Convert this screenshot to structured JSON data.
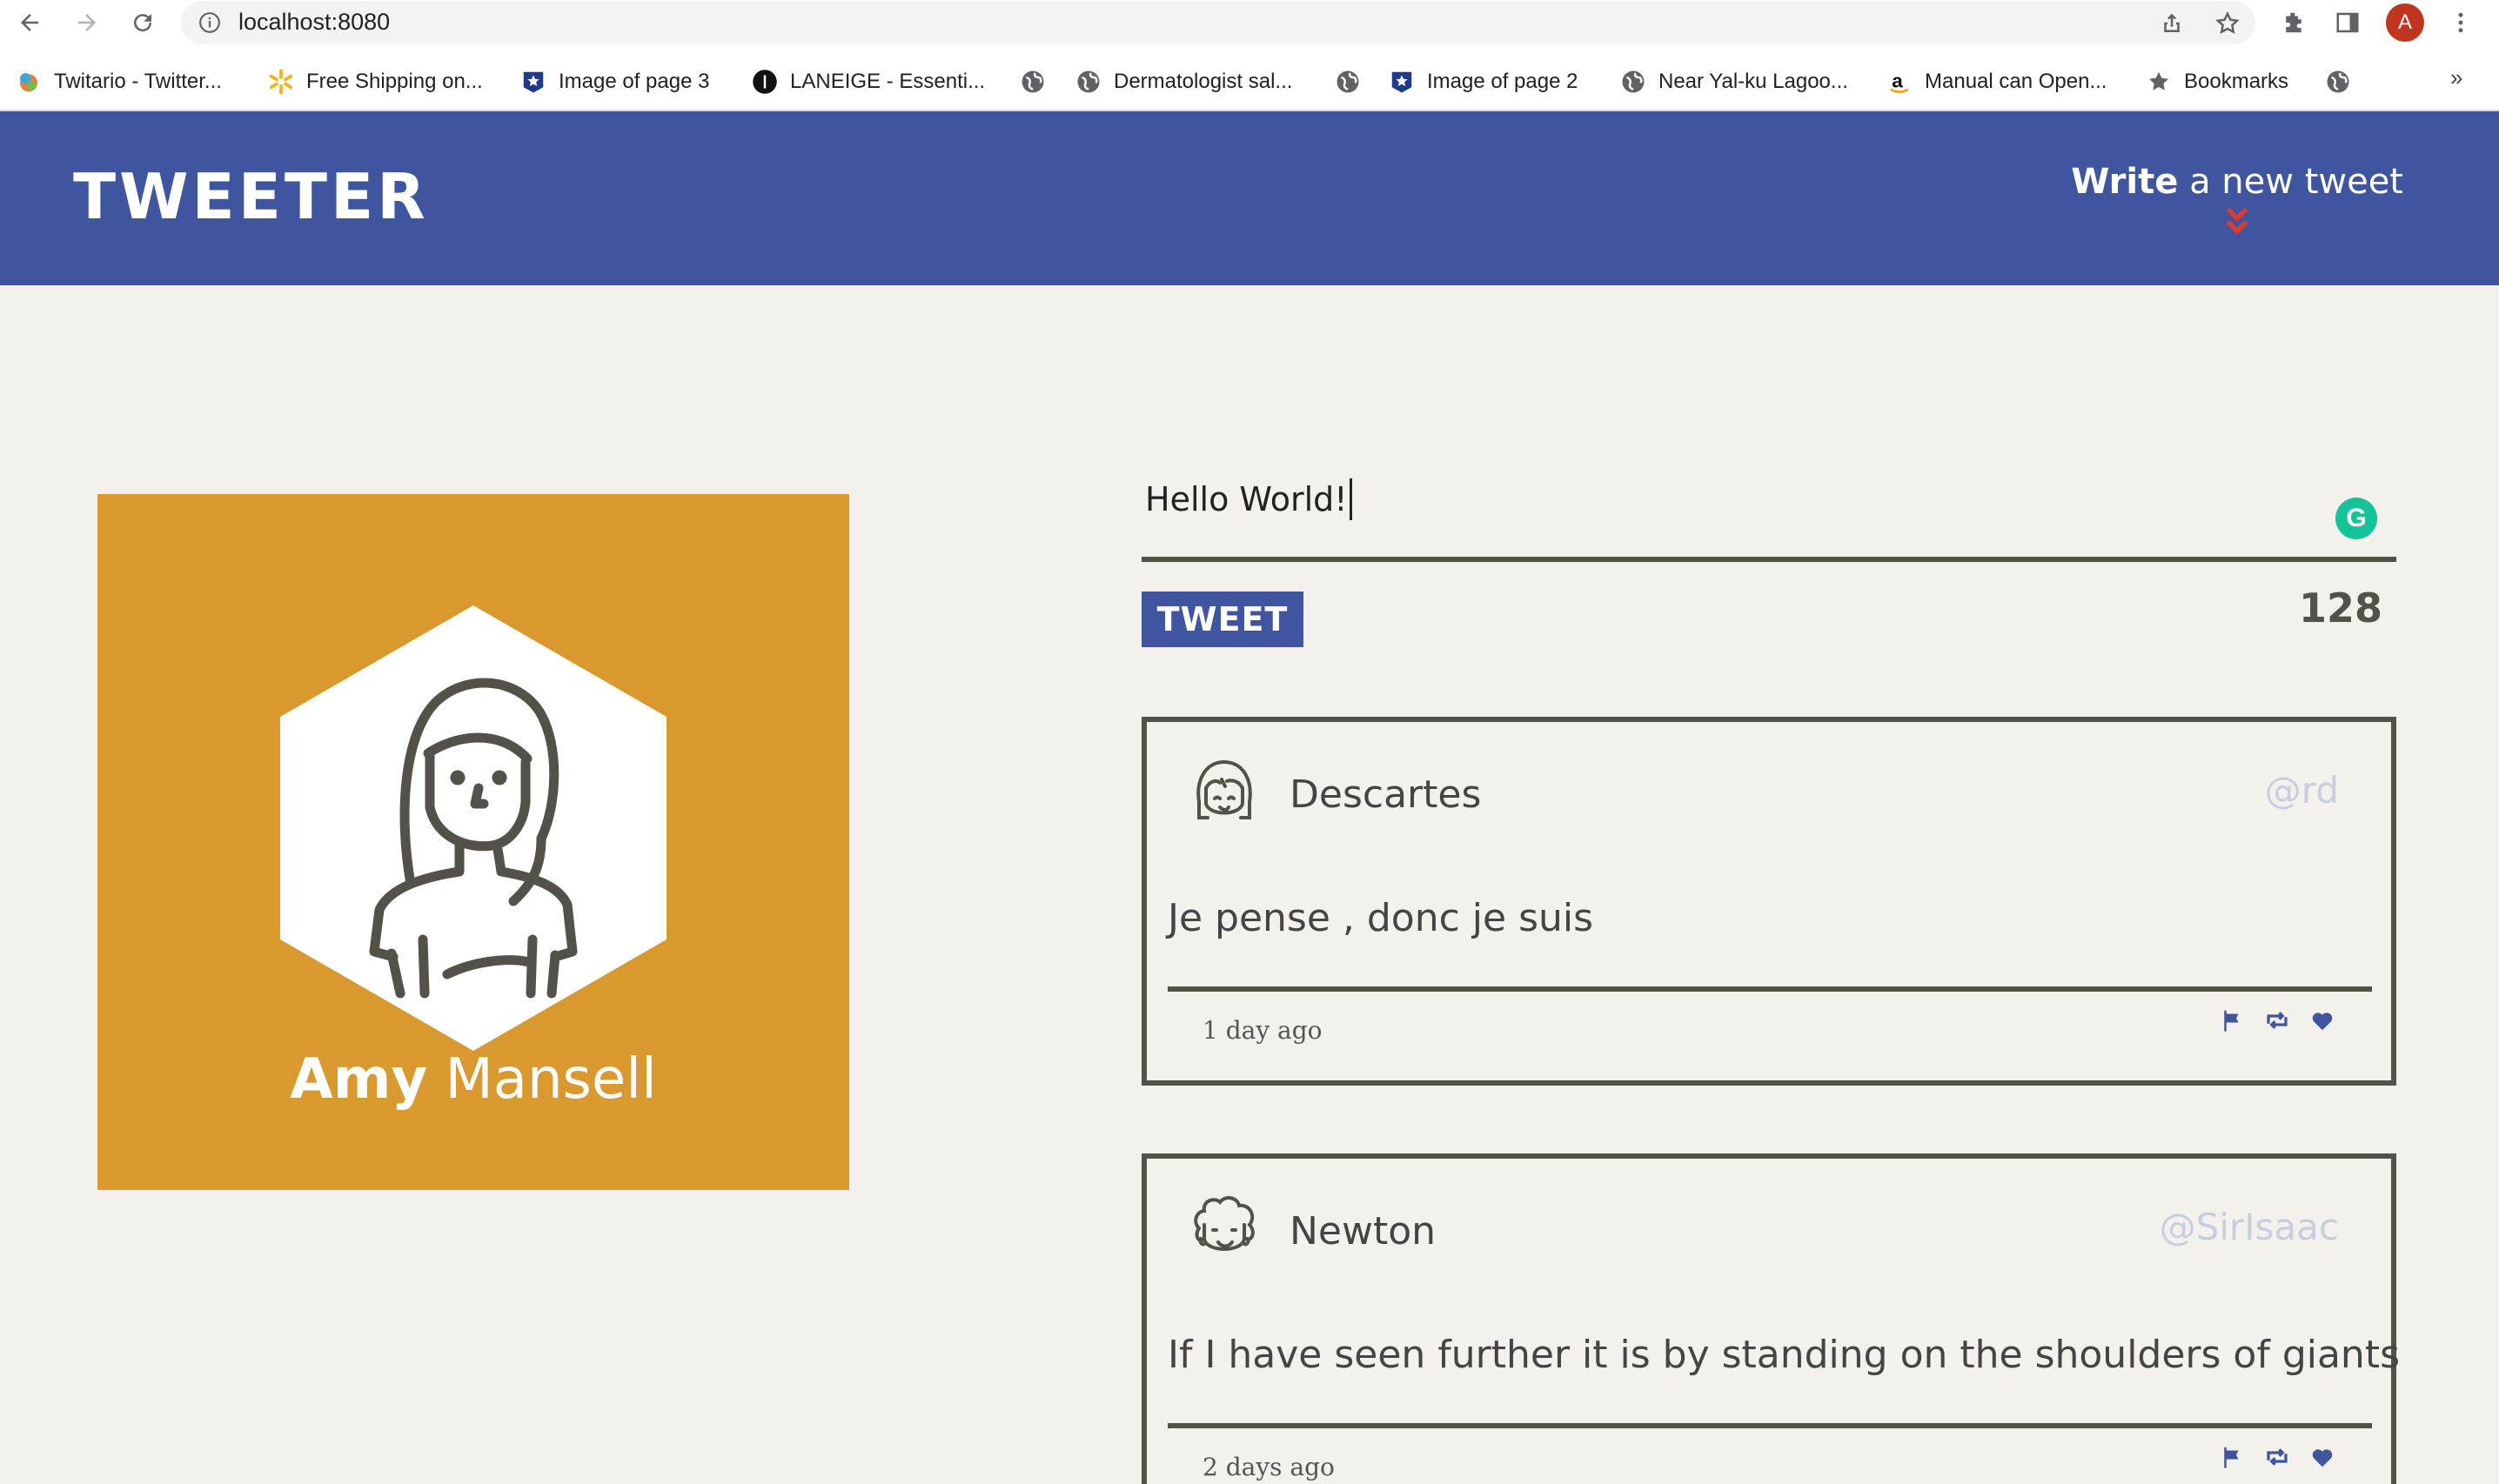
{
  "browser": {
    "url": "localhost:8080",
    "profile_initial": "A",
    "bookmarks": [
      {
        "label": "Twitario - Twitter...",
        "icon": "colorful-logo-icon"
      },
      {
        "label": "Free Shipping on...",
        "icon": "walmart-spark-icon"
      },
      {
        "label": "Image of page 3",
        "icon": "star-shield-icon"
      },
      {
        "label": "LANEIGE - Essenti...",
        "icon": "black-circle-icon"
      },
      {
        "label": "",
        "icon": "globe-icon"
      },
      {
        "label": "Dermatologist sal...",
        "icon": "globe-icon"
      },
      {
        "label": "",
        "icon": "globe-icon"
      },
      {
        "label": "Image of page 2",
        "icon": "star-shield-icon"
      },
      {
        "label": "Near Yal-ku Lagoo...",
        "icon": "globe-icon"
      },
      {
        "label": "Manual can Open...",
        "icon": "amazon-icon"
      },
      {
        "label": "Bookmarks",
        "icon": "star-icon"
      },
      {
        "label": "",
        "icon": "globe-icon"
      }
    ],
    "more": "»"
  },
  "app": {
    "logo": "TWEETER",
    "write_bold": "Write",
    "write_rest": " a new tweet",
    "accent": "#4055a0",
    "chevron_color": "#e0392b"
  },
  "profile": {
    "first_name": "Amy",
    "last_name": " Mansell",
    "bg_color": "#d9992f"
  },
  "composer": {
    "text": "Hello World!",
    "button_label": "TWEET",
    "counter": "128"
  },
  "tweets": [
    {
      "name": "Descartes",
      "handle": "@rd",
      "text": "Je pense , donc je suis",
      "date": "1 day ago"
    },
    {
      "name": "Newton",
      "handle": "@SirIsaac",
      "text": "If I have seen further it is by standing on the shoulders of giants",
      "date": "2 days ago"
    }
  ]
}
